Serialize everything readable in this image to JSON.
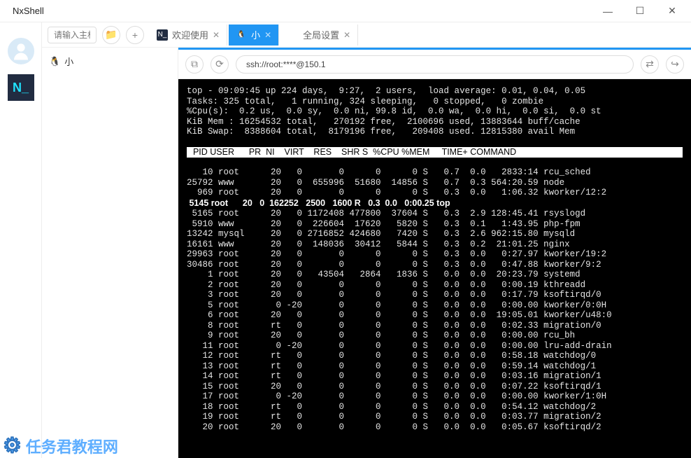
{
  "window": {
    "title": "NxShell",
    "min": "—",
    "max": "☐",
    "close": "✕"
  },
  "leftbar": {
    "app_icon_text": "N_"
  },
  "hostRow": {
    "placeholder": "请输入主机"
  },
  "tabs": [
    {
      "label": "欢迎使用",
      "active": false,
      "closable": true
    },
    {
      "label": "小",
      "active": true,
      "closable": true
    },
    {
      "label": "全局设置",
      "active": false,
      "closable": true
    }
  ],
  "tree": {
    "item0": "小"
  },
  "address": {
    "url": "ssh://root:****@150.1"
  },
  "term": {
    "line1": "top - 09:09:45 up 224 days,  9:27,  2 users,  load average: 0.01, 0.04, 0.05",
    "line2": "Tasks: 325 total,   1 running, 324 sleeping,   0 stopped,   0 zombie",
    "line3": "%Cpu(s):  0.2 us,  0.0 sy,  0.0 ni, 99.8 id,  0.0 wa,  0.0 hi,  0.0 si,  0.0 st",
    "line4": "KiB Mem : 16254532 total,   270192 free,  2100696 used, 13883644 buff/cache",
    "line5": "KiB Swap:  8388604 total,  8179196 free,   209408 used. 12815380 avail Mem",
    "header": "  PID USER      PR  NI    VIRT    RES    SHR S  %CPU %MEM     TIME+ COMMAND      ",
    "rows": [
      "   10 root      20   0       0      0      0 S   0.7  0.0   2833:14 rcu_sched",
      "25792 www       20   0  655996  51680  14856 S   0.7  0.3 564:20.59 node",
      "  969 root      20   0       0      0      0 S   0.3  0.0   1:06.32 kworker/12:2",
      " 5145 root      20   0  162252   2500   1600 R   0.3  0.0   0:00.25 top",
      " 5165 root      20   0 1172408 477800  37604 S   0.3  2.9 128:45.41 rsyslogd",
      " 5910 www       20   0  226604  17620   5820 S   0.3  0.1   1:43.95 php-fpm",
      "13242 mysql     20   0 2716852 424680   7420 S   0.3  2.6 962:15.80 mysqld",
      "16161 www       20   0  148036  30412   5844 S   0.3  0.2  21:01.25 nginx",
      "29963 root      20   0       0      0      0 S   0.3  0.0   0:27.97 kworker/19:2",
      "30486 root      20   0       0      0      0 S   0.3  0.0   0:47.88 kworker/9:2",
      "    1 root      20   0   43504   2864   1836 S   0.0  0.0  20:23.79 systemd",
      "    2 root      20   0       0      0      0 S   0.0  0.0   0:00.19 kthreadd",
      "    3 root      20   0       0      0      0 S   0.0  0.0   0:17.79 ksoftirqd/0",
      "    5 root       0 -20       0      0      0 S   0.0  0.0   0:00.00 kworker/0:0H",
      "    6 root      20   0       0      0      0 S   0.0  0.0  19:05.01 kworker/u48:0",
      "    8 root      rt   0       0      0      0 S   0.0  0.0   0:02.33 migration/0",
      "    9 root      20   0       0      0      0 S   0.0  0.0   0:00.00 rcu_bh",
      "   11 root       0 -20       0      0      0 S   0.0  0.0   0:00.00 lru-add-drain",
      "   12 root      rt   0       0      0      0 S   0.0  0.0   0:58.18 watchdog/0",
      "   13 root      rt   0       0      0      0 S   0.0  0.0   0:59.14 watchdog/1",
      "   14 root      rt   0       0      0      0 S   0.0  0.0   0:03.16 migration/1",
      "   15 root      20   0       0      0      0 S   0.0  0.0   0:07.22 ksoftirqd/1",
      "   17 root       0 -20       0      0      0 S   0.0  0.0   0:00.00 kworker/1:0H",
      "   18 root      rt   0       0      0      0 S   0.0  0.0   0:54.12 watchdog/2",
      "   19 root      rt   0       0      0      0 S   0.0  0.0   0:03.77 migration/2",
      "   20 root      20   0       0      0      0 S   0.0  0.0   0:05.67 ksoftirqd/2"
    ],
    "highlight_row_index": 3
  },
  "watermark": "任务君教程网"
}
